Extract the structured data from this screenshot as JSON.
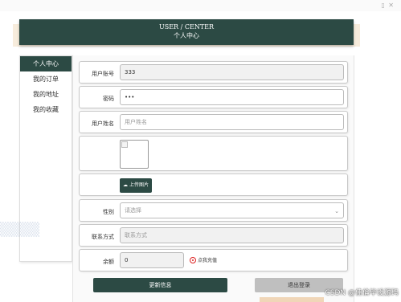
{
  "header": {
    "title_en": "USER / CENTER",
    "title_cn": "个人中心"
  },
  "sidebar": {
    "items": [
      {
        "label": "个人中心",
        "active": true
      },
      {
        "label": "我的订单"
      },
      {
        "label": "我的地址"
      },
      {
        "label": "我的收藏"
      }
    ]
  },
  "form": {
    "account": {
      "label": "用户账号",
      "value": "333"
    },
    "password": {
      "label": "密码",
      "value": "•••"
    },
    "name": {
      "label": "用户姓名",
      "placeholder": "用户姓名"
    },
    "upload": {
      "button_label": "上传图片"
    },
    "gender": {
      "label": "性别",
      "value": "请选择"
    },
    "contact": {
      "label": "联系方式",
      "placeholder": "联系方式"
    },
    "balance": {
      "label": "余额",
      "value": "0",
      "recharge_label": "点我充值"
    }
  },
  "actions": {
    "update_label": "更新信息",
    "logout_label": "退出登录"
  },
  "watermark": "CSDN @佳倫毕设源码",
  "colors": {
    "accent": "#2c4a44",
    "danger": "#d22222"
  }
}
